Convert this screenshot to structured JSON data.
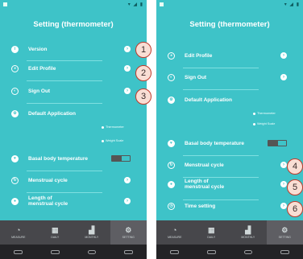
{
  "left": {
    "title": "Setting (thermometer)",
    "rows": [
      {
        "label": "Version"
      },
      {
        "label": "Edit Profile"
      },
      {
        "label": "Sign Out"
      },
      {
        "label": "Default Application"
      },
      {
        "label": "Basal body temperature"
      },
      {
        "label": "Menstrual cycle"
      },
      {
        "label": "Length of menstrual cycle"
      }
    ],
    "options": [
      "Thermometer",
      "Weight Scale"
    ]
  },
  "right": {
    "title": "Setting (thermometer)",
    "rows": [
      {
        "label": "Edit Profile"
      },
      {
        "label": "Sign Out"
      },
      {
        "label": "Default Application"
      },
      {
        "label": "Basal body temperature"
      },
      {
        "label": "Menstrual cycle"
      },
      {
        "label": "Length of menstrual cycle"
      },
      {
        "label": "Time setting"
      }
    ],
    "options": [
      "Thermometer",
      "Weight Scale"
    ]
  },
  "nav": [
    "MEASURE",
    "DAILY",
    "MONTHLY",
    "SETTING"
  ],
  "nav_icons": [
    "speedometer-icon",
    "calendar-icon",
    "bar-chart-icon",
    "gear-icon"
  ],
  "badges": [
    "1",
    "2",
    "3",
    "4",
    "5",
    "6"
  ],
  "colors": {
    "accent": "#3ec3c8",
    "navbar": "#47474b",
    "badge_fill": "#f9ded4",
    "badge_border": "#c0392b"
  }
}
